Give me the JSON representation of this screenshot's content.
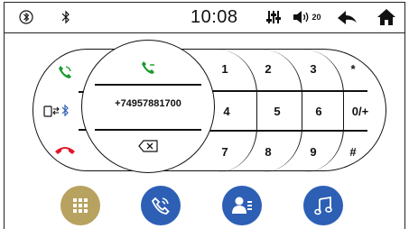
{
  "status_bar": {
    "icons": [
      "settings-circle-icon",
      "bluetooth-icon",
      "equalizer-icon",
      "volume-icon",
      "back-icon",
      "home-icon"
    ],
    "time": "10:08",
    "volume_level": "20"
  },
  "dialer": {
    "number": "+74957881700",
    "left_icons": [
      "accept-call-icon",
      "phone-bluetooth-transfer-icon",
      "end-call-icon"
    ],
    "circle_icons": [
      "call-icon",
      "backspace-icon"
    ],
    "keys": [
      [
        "1",
        "2",
        "3",
        "*"
      ],
      [
        "4",
        "5",
        "6",
        "0/+"
      ],
      [
        "7",
        "8",
        "9",
        "#"
      ]
    ]
  },
  "colors": {
    "accent_green": "#1a9b2c",
    "end_red": "#e0182a",
    "keypad_nav": "#b8a25f",
    "nav_blue": "#2d5fb5"
  },
  "bottom_nav": {
    "items": [
      "dialpad-icon",
      "phone-icon",
      "contacts-icon",
      "music-icon"
    ]
  }
}
